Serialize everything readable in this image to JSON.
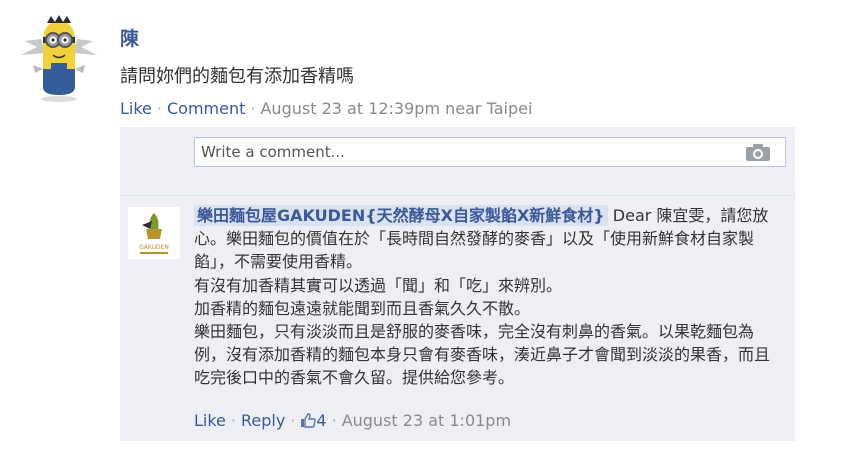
{
  "post": {
    "author": "陳",
    "text": "請問妳們的麵包有添加香精嗎",
    "like_label": "Like",
    "comment_label": "Comment",
    "timestamp": "August 23 at 12:39pm near Taipei"
  },
  "composer": {
    "placeholder": "Write a comment..."
  },
  "reply": {
    "page_name": "樂田麵包屋GAKUDEN{天然酵母X自家製餡X新鮮食材}",
    "text": " Dear 陳宜雯，請您放心。樂田麵包的價值在於「長時間自然發酵的麥香」以及「使用新鮮食材自家製餡」，不需要使用香精。",
    "line2": "有沒有加香精其實可以透過「聞」和「吃」來辨別。",
    "line3": "加香精的麵包遠遠就能聞到而且香氣久久不散。",
    "line4": "樂田麵包，只有淡淡而且是舒服的麥香味，完全沒有刺鼻的香氣。以果乾麵包為例，沒有添加香精的麵包本身只會有麥香味，湊近鼻子才會聞到淡淡的果香，而且吃完後口中的香氣不會久留。提供給您參考。",
    "like_label": "Like",
    "reply_label": "Reply",
    "like_count": "4",
    "timestamp": "August 23 at 1:01pm",
    "logo_text": "GAKUDEN"
  },
  "colors": {
    "link": "#3b5998",
    "meta": "#8a8a8a",
    "panel": "#edeff4"
  }
}
